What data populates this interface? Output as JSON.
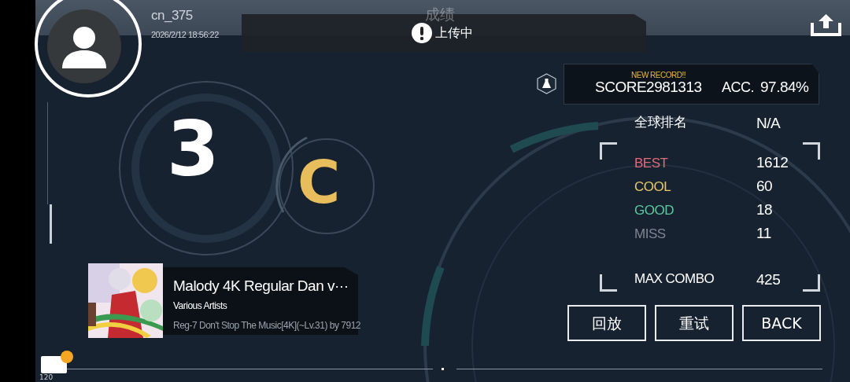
{
  "user": {
    "name": "cn_375",
    "timestamp": "2026/2/12 18:56:22"
  },
  "title": "成绩",
  "toast": {
    "text": "上传中"
  },
  "score": {
    "new_record": "NEW RECORD!!",
    "score_label": "SCORE",
    "score": "2981313",
    "acc_label": "ACC.",
    "acc": "97.84%"
  },
  "level": "3",
  "grade": {
    "text": "C",
    "color": "#e8bd5c"
  },
  "song": {
    "title": "Malody 4K Regular Dan v···",
    "artist": "Various Artists",
    "chart": "Reg-7 Don't Stop The Music[4K](~Lv.31) by 7912"
  },
  "ranking": {
    "label": "全球排名",
    "value": "N/A"
  },
  "judgements": [
    {
      "label": "BEST",
      "value": "1612",
      "color": "#e06a78"
    },
    {
      "label": "COOL",
      "value": "60",
      "color": "#e8c86a"
    },
    {
      "label": "GOOD",
      "value": "18",
      "color": "#5cc8a0"
    },
    {
      "label": "MISS",
      "value": "11",
      "color": "#7d8590"
    }
  ],
  "max_combo": {
    "label": "MAX COMBO",
    "value": "425"
  },
  "buttons": [
    {
      "label": "回放"
    },
    {
      "label": "重试"
    },
    {
      "label": "BACK"
    }
  ],
  "footer": {
    "counter": "120"
  }
}
